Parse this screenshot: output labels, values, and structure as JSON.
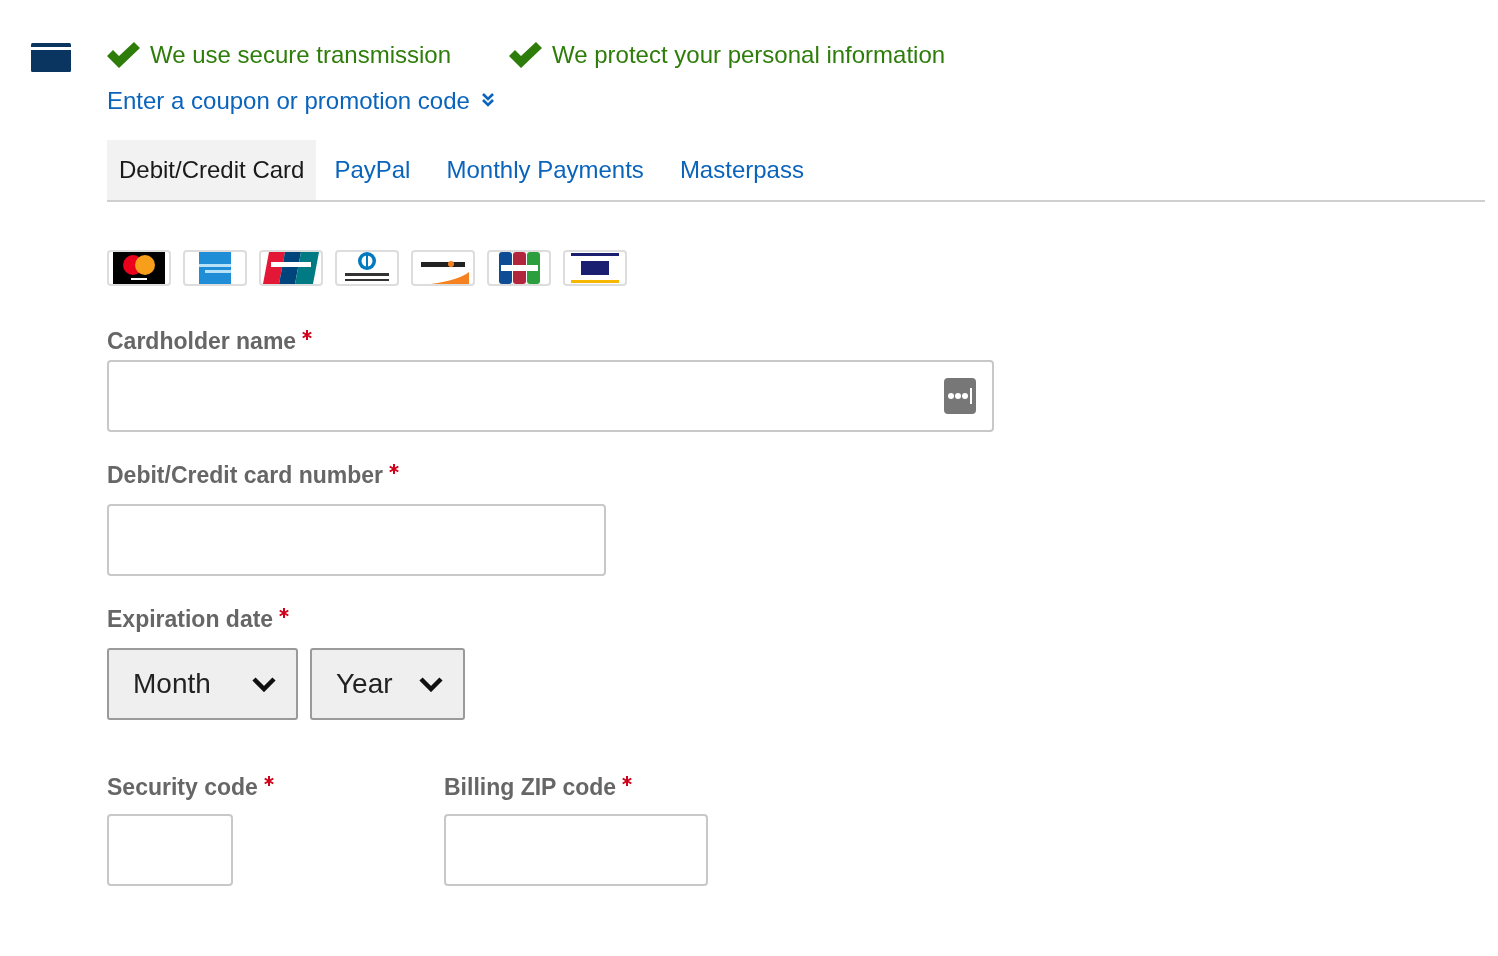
{
  "trust_badges": [
    "We use secure transmission",
    "We protect your personal information"
  ],
  "coupon_link": {
    "text": "Enter a coupon or promotion code",
    "expanded": false
  },
  "tabs": [
    {
      "label": "Debit/Credit Card",
      "selected": true
    },
    {
      "label": "PayPal",
      "selected": false
    },
    {
      "label": "Monthly Payments",
      "selected": false
    },
    {
      "label": "Masterpass",
      "selected": false
    }
  ],
  "card_logos": [
    {
      "kind": "circles"
    },
    {
      "kind": "blue"
    },
    {
      "kind": "stripes3"
    },
    {
      "kind": "ring"
    },
    {
      "kind": "swoosh"
    },
    {
      "kind": "stripes3b"
    },
    {
      "kind": "bands"
    }
  ],
  "form": {
    "cardholder_name": {
      "label": "Cardholder name",
      "required": true,
      "autofill_button": true
    },
    "card_number": {
      "label": "Debit/Credit card number",
      "required": true
    },
    "expiration": {
      "label": "Expiration date",
      "required": true,
      "selects": [
        {
          "value": "Month"
        },
        {
          "value": "Year"
        }
      ]
    },
    "security_code": {
      "label": "Security code",
      "required": true
    },
    "billing_zip": {
      "label": "Billing ZIP code",
      "required": true
    }
  }
}
